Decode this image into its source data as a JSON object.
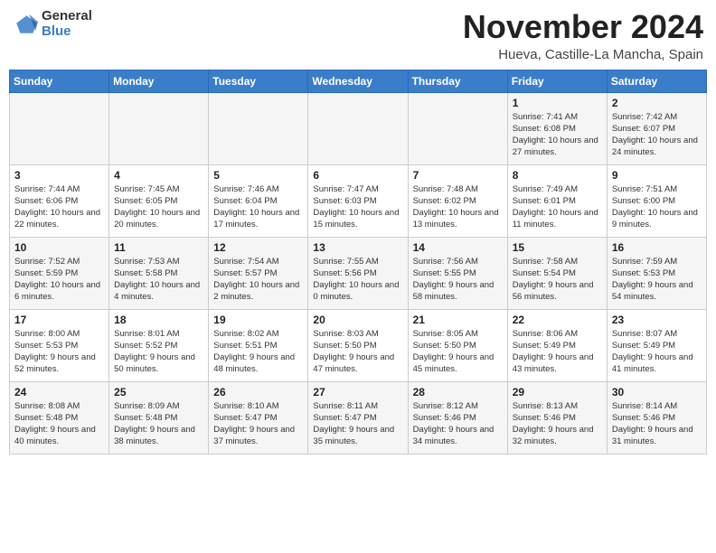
{
  "header": {
    "logo_general": "General",
    "logo_blue": "Blue",
    "month": "November 2024",
    "location": "Hueva, Castille-La Mancha, Spain"
  },
  "weekdays": [
    "Sunday",
    "Monday",
    "Tuesday",
    "Wednesday",
    "Thursday",
    "Friday",
    "Saturday"
  ],
  "weeks": [
    [
      {
        "day": "",
        "info": ""
      },
      {
        "day": "",
        "info": ""
      },
      {
        "day": "",
        "info": ""
      },
      {
        "day": "",
        "info": ""
      },
      {
        "day": "",
        "info": ""
      },
      {
        "day": "1",
        "info": "Sunrise: 7:41 AM\nSunset: 6:08 PM\nDaylight: 10 hours and 27 minutes."
      },
      {
        "day": "2",
        "info": "Sunrise: 7:42 AM\nSunset: 6:07 PM\nDaylight: 10 hours and 24 minutes."
      }
    ],
    [
      {
        "day": "3",
        "info": "Sunrise: 7:44 AM\nSunset: 6:06 PM\nDaylight: 10 hours and 22 minutes."
      },
      {
        "day": "4",
        "info": "Sunrise: 7:45 AM\nSunset: 6:05 PM\nDaylight: 10 hours and 20 minutes."
      },
      {
        "day": "5",
        "info": "Sunrise: 7:46 AM\nSunset: 6:04 PM\nDaylight: 10 hours and 17 minutes."
      },
      {
        "day": "6",
        "info": "Sunrise: 7:47 AM\nSunset: 6:03 PM\nDaylight: 10 hours and 15 minutes."
      },
      {
        "day": "7",
        "info": "Sunrise: 7:48 AM\nSunset: 6:02 PM\nDaylight: 10 hours and 13 minutes."
      },
      {
        "day": "8",
        "info": "Sunrise: 7:49 AM\nSunset: 6:01 PM\nDaylight: 10 hours and 11 minutes."
      },
      {
        "day": "9",
        "info": "Sunrise: 7:51 AM\nSunset: 6:00 PM\nDaylight: 10 hours and 9 minutes."
      }
    ],
    [
      {
        "day": "10",
        "info": "Sunrise: 7:52 AM\nSunset: 5:59 PM\nDaylight: 10 hours and 6 minutes."
      },
      {
        "day": "11",
        "info": "Sunrise: 7:53 AM\nSunset: 5:58 PM\nDaylight: 10 hours and 4 minutes."
      },
      {
        "day": "12",
        "info": "Sunrise: 7:54 AM\nSunset: 5:57 PM\nDaylight: 10 hours and 2 minutes."
      },
      {
        "day": "13",
        "info": "Sunrise: 7:55 AM\nSunset: 5:56 PM\nDaylight: 10 hours and 0 minutes."
      },
      {
        "day": "14",
        "info": "Sunrise: 7:56 AM\nSunset: 5:55 PM\nDaylight: 9 hours and 58 minutes."
      },
      {
        "day": "15",
        "info": "Sunrise: 7:58 AM\nSunset: 5:54 PM\nDaylight: 9 hours and 56 minutes."
      },
      {
        "day": "16",
        "info": "Sunrise: 7:59 AM\nSunset: 5:53 PM\nDaylight: 9 hours and 54 minutes."
      }
    ],
    [
      {
        "day": "17",
        "info": "Sunrise: 8:00 AM\nSunset: 5:53 PM\nDaylight: 9 hours and 52 minutes."
      },
      {
        "day": "18",
        "info": "Sunrise: 8:01 AM\nSunset: 5:52 PM\nDaylight: 9 hours and 50 minutes."
      },
      {
        "day": "19",
        "info": "Sunrise: 8:02 AM\nSunset: 5:51 PM\nDaylight: 9 hours and 48 minutes."
      },
      {
        "day": "20",
        "info": "Sunrise: 8:03 AM\nSunset: 5:50 PM\nDaylight: 9 hours and 47 minutes."
      },
      {
        "day": "21",
        "info": "Sunrise: 8:05 AM\nSunset: 5:50 PM\nDaylight: 9 hours and 45 minutes."
      },
      {
        "day": "22",
        "info": "Sunrise: 8:06 AM\nSunset: 5:49 PM\nDaylight: 9 hours and 43 minutes."
      },
      {
        "day": "23",
        "info": "Sunrise: 8:07 AM\nSunset: 5:49 PM\nDaylight: 9 hours and 41 minutes."
      }
    ],
    [
      {
        "day": "24",
        "info": "Sunrise: 8:08 AM\nSunset: 5:48 PM\nDaylight: 9 hours and 40 minutes."
      },
      {
        "day": "25",
        "info": "Sunrise: 8:09 AM\nSunset: 5:48 PM\nDaylight: 9 hours and 38 minutes."
      },
      {
        "day": "26",
        "info": "Sunrise: 8:10 AM\nSunset: 5:47 PM\nDaylight: 9 hours and 37 minutes."
      },
      {
        "day": "27",
        "info": "Sunrise: 8:11 AM\nSunset: 5:47 PM\nDaylight: 9 hours and 35 minutes."
      },
      {
        "day": "28",
        "info": "Sunrise: 8:12 AM\nSunset: 5:46 PM\nDaylight: 9 hours and 34 minutes."
      },
      {
        "day": "29",
        "info": "Sunrise: 8:13 AM\nSunset: 5:46 PM\nDaylight: 9 hours and 32 minutes."
      },
      {
        "day": "30",
        "info": "Sunrise: 8:14 AM\nSunset: 5:46 PM\nDaylight: 9 hours and 31 minutes."
      }
    ]
  ]
}
